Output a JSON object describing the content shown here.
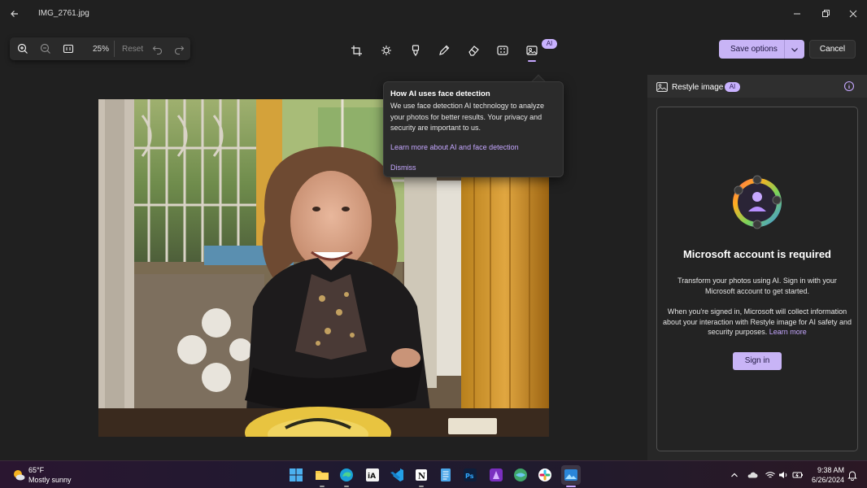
{
  "titlebar": {
    "filename": "IMG_2761.jpg"
  },
  "zoom_bar": {
    "zoom_percent": "25%",
    "reset_label": "Reset"
  },
  "edit_tools": {
    "items": [
      "crop-icon",
      "adjust-brightness-icon",
      "filter-icon",
      "markup-pen-icon",
      "erase-icon",
      "background-icon",
      "restyle-icon"
    ],
    "ai_badge": "AI"
  },
  "actions": {
    "save_label": "Save options",
    "cancel_label": "Cancel"
  },
  "tooltip": {
    "title": "How AI uses face detection",
    "body": "We use face detection AI technology to analyze your photos for better results. Your privacy and security are important to us.",
    "link": "Learn more about AI and face detection",
    "dismiss": "Dismiss"
  },
  "panel": {
    "title": "Restyle image",
    "ai_badge": "AI",
    "heading": "Microsoft account is required",
    "paragraph1": "Transform your photos using AI. Sign in with your Microsoft account to get started.",
    "paragraph2": "When you're signed in, Microsoft will collect information about your interaction with Restyle image for AI safety and security purposes.",
    "learn_more": "Learn more",
    "signin_label": "Sign in"
  },
  "taskbar": {
    "weather_temp": "65°F",
    "weather_condition": "Mostly sunny",
    "apps": [
      "windows-start",
      "file-explorer",
      "edge",
      "ia-writer",
      "vs-code",
      "notion",
      "notepad",
      "photoshop",
      "affinity",
      "maps",
      "slack",
      "photos"
    ],
    "time": "9:38 AM",
    "date": "6/26/2024"
  },
  "colors": {
    "accent": "#c8b4f6",
    "link": "#c5a7ff",
    "background": "#202020"
  }
}
